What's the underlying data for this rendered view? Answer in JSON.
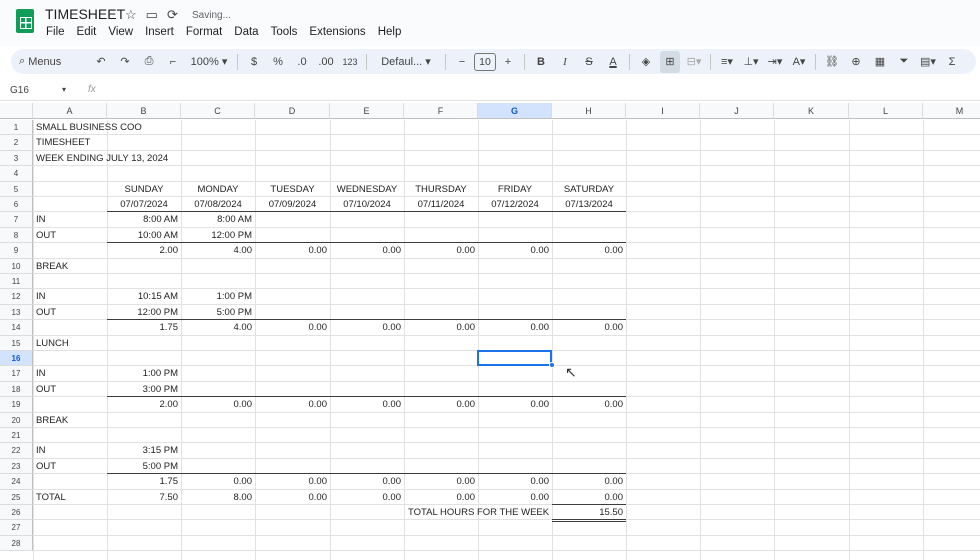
{
  "app": {
    "title": "TIMESHEET",
    "status": "Saving...",
    "menus": [
      "File",
      "Edit",
      "View",
      "Insert",
      "Format",
      "Data",
      "Tools",
      "Extensions",
      "Help"
    ]
  },
  "toolbar": {
    "search": "Menus",
    "zoom": "100%",
    "currency": "$",
    "percent": "%",
    "dec_dec": ".0",
    "inc_dec": ".00",
    "numfmt": "123",
    "font": "Defaul...",
    "font_size": "10",
    "minus": "−",
    "plus": "+",
    "bold": "B",
    "italic": "I",
    "strike": "S",
    "textcolor": "A"
  },
  "formula": {
    "namebox": "G16",
    "fx": "fx",
    "value": ""
  },
  "columns": [
    "A",
    "B",
    "C",
    "D",
    "E",
    "F",
    "G",
    "H",
    "I",
    "J",
    "K",
    "L",
    "M"
  ],
  "rows": [
    "1",
    "2",
    "3",
    "4",
    "5",
    "6",
    "7",
    "8",
    "9",
    "10",
    "11",
    "12",
    "13",
    "14",
    "15",
    "16",
    "17",
    "18",
    "19",
    "20",
    "21",
    "22",
    "23",
    "24",
    "25",
    "26",
    "27",
    "28"
  ],
  "sheet": {
    "r1": {
      "A": "SMALL BUSINESS COO"
    },
    "r2": {
      "A": "TIMESHEET"
    },
    "r3": {
      "A": "WEEK ENDING JULY 13, 2024"
    },
    "r5": {
      "B": "SUNDAY",
      "C": "MONDAY",
      "D": "TUESDAY",
      "E": "WEDNESDAY",
      "F": "THURSDAY",
      "G": "FRIDAY",
      "H": "SATURDAY"
    },
    "r6": {
      "B": "07/07/2024",
      "C": "07/08/2024",
      "D": "07/09/2024",
      "E": "07/10/2024",
      "F": "07/11/2024",
      "G": "07/12/2024",
      "H": "07/13/2024"
    },
    "r7": {
      "A": "IN",
      "B": "8:00 AM",
      "C": "8:00 AM"
    },
    "r8": {
      "A": "OUT",
      "B": "10:00 AM",
      "C": "12:00 PM"
    },
    "r9": {
      "B": "2.00",
      "C": "4.00",
      "D": "0.00",
      "E": "0.00",
      "F": "0.00",
      "G": "0.00",
      "H": "0.00"
    },
    "r10": {
      "A": "BREAK"
    },
    "r12": {
      "A": "IN",
      "B": "10:15 AM",
      "C": "1:00 PM"
    },
    "r13": {
      "A": "OUT",
      "B": "12:00 PM",
      "C": "5:00 PM"
    },
    "r14": {
      "B": "1.75",
      "C": "4.00",
      "D": "0.00",
      "E": "0.00",
      "F": "0.00",
      "G": "0.00",
      "H": "0.00"
    },
    "r15": {
      "A": "LUNCH"
    },
    "r17": {
      "A": "IN",
      "B": "1:00 PM"
    },
    "r18": {
      "A": "OUT",
      "B": "3:00 PM"
    },
    "r19": {
      "B": "2.00",
      "C": "0.00",
      "D": "0.00",
      "E": "0.00",
      "F": "0.00",
      "G": "0.00",
      "H": "0.00"
    },
    "r20": {
      "A": "BREAK"
    },
    "r22": {
      "A": "IN",
      "B": "3:15 PM"
    },
    "r23": {
      "A": "OUT",
      "B": "5:00 PM"
    },
    "r24": {
      "B": "1.75",
      "C": "0.00",
      "D": "0.00",
      "E": "0.00",
      "F": "0.00",
      "G": "0.00",
      "H": "0.00"
    },
    "r25": {
      "A": "TOTAL",
      "B": "7.50",
      "C": "8.00",
      "D": "0.00",
      "E": "0.00",
      "F": "0.00",
      "G": "0.00",
      "H": "0.00"
    },
    "r26": {
      "F": "TOTAL HOURS FOR THE WEEK",
      "H": "15.50"
    }
  },
  "selected": {
    "cell": "G16"
  }
}
